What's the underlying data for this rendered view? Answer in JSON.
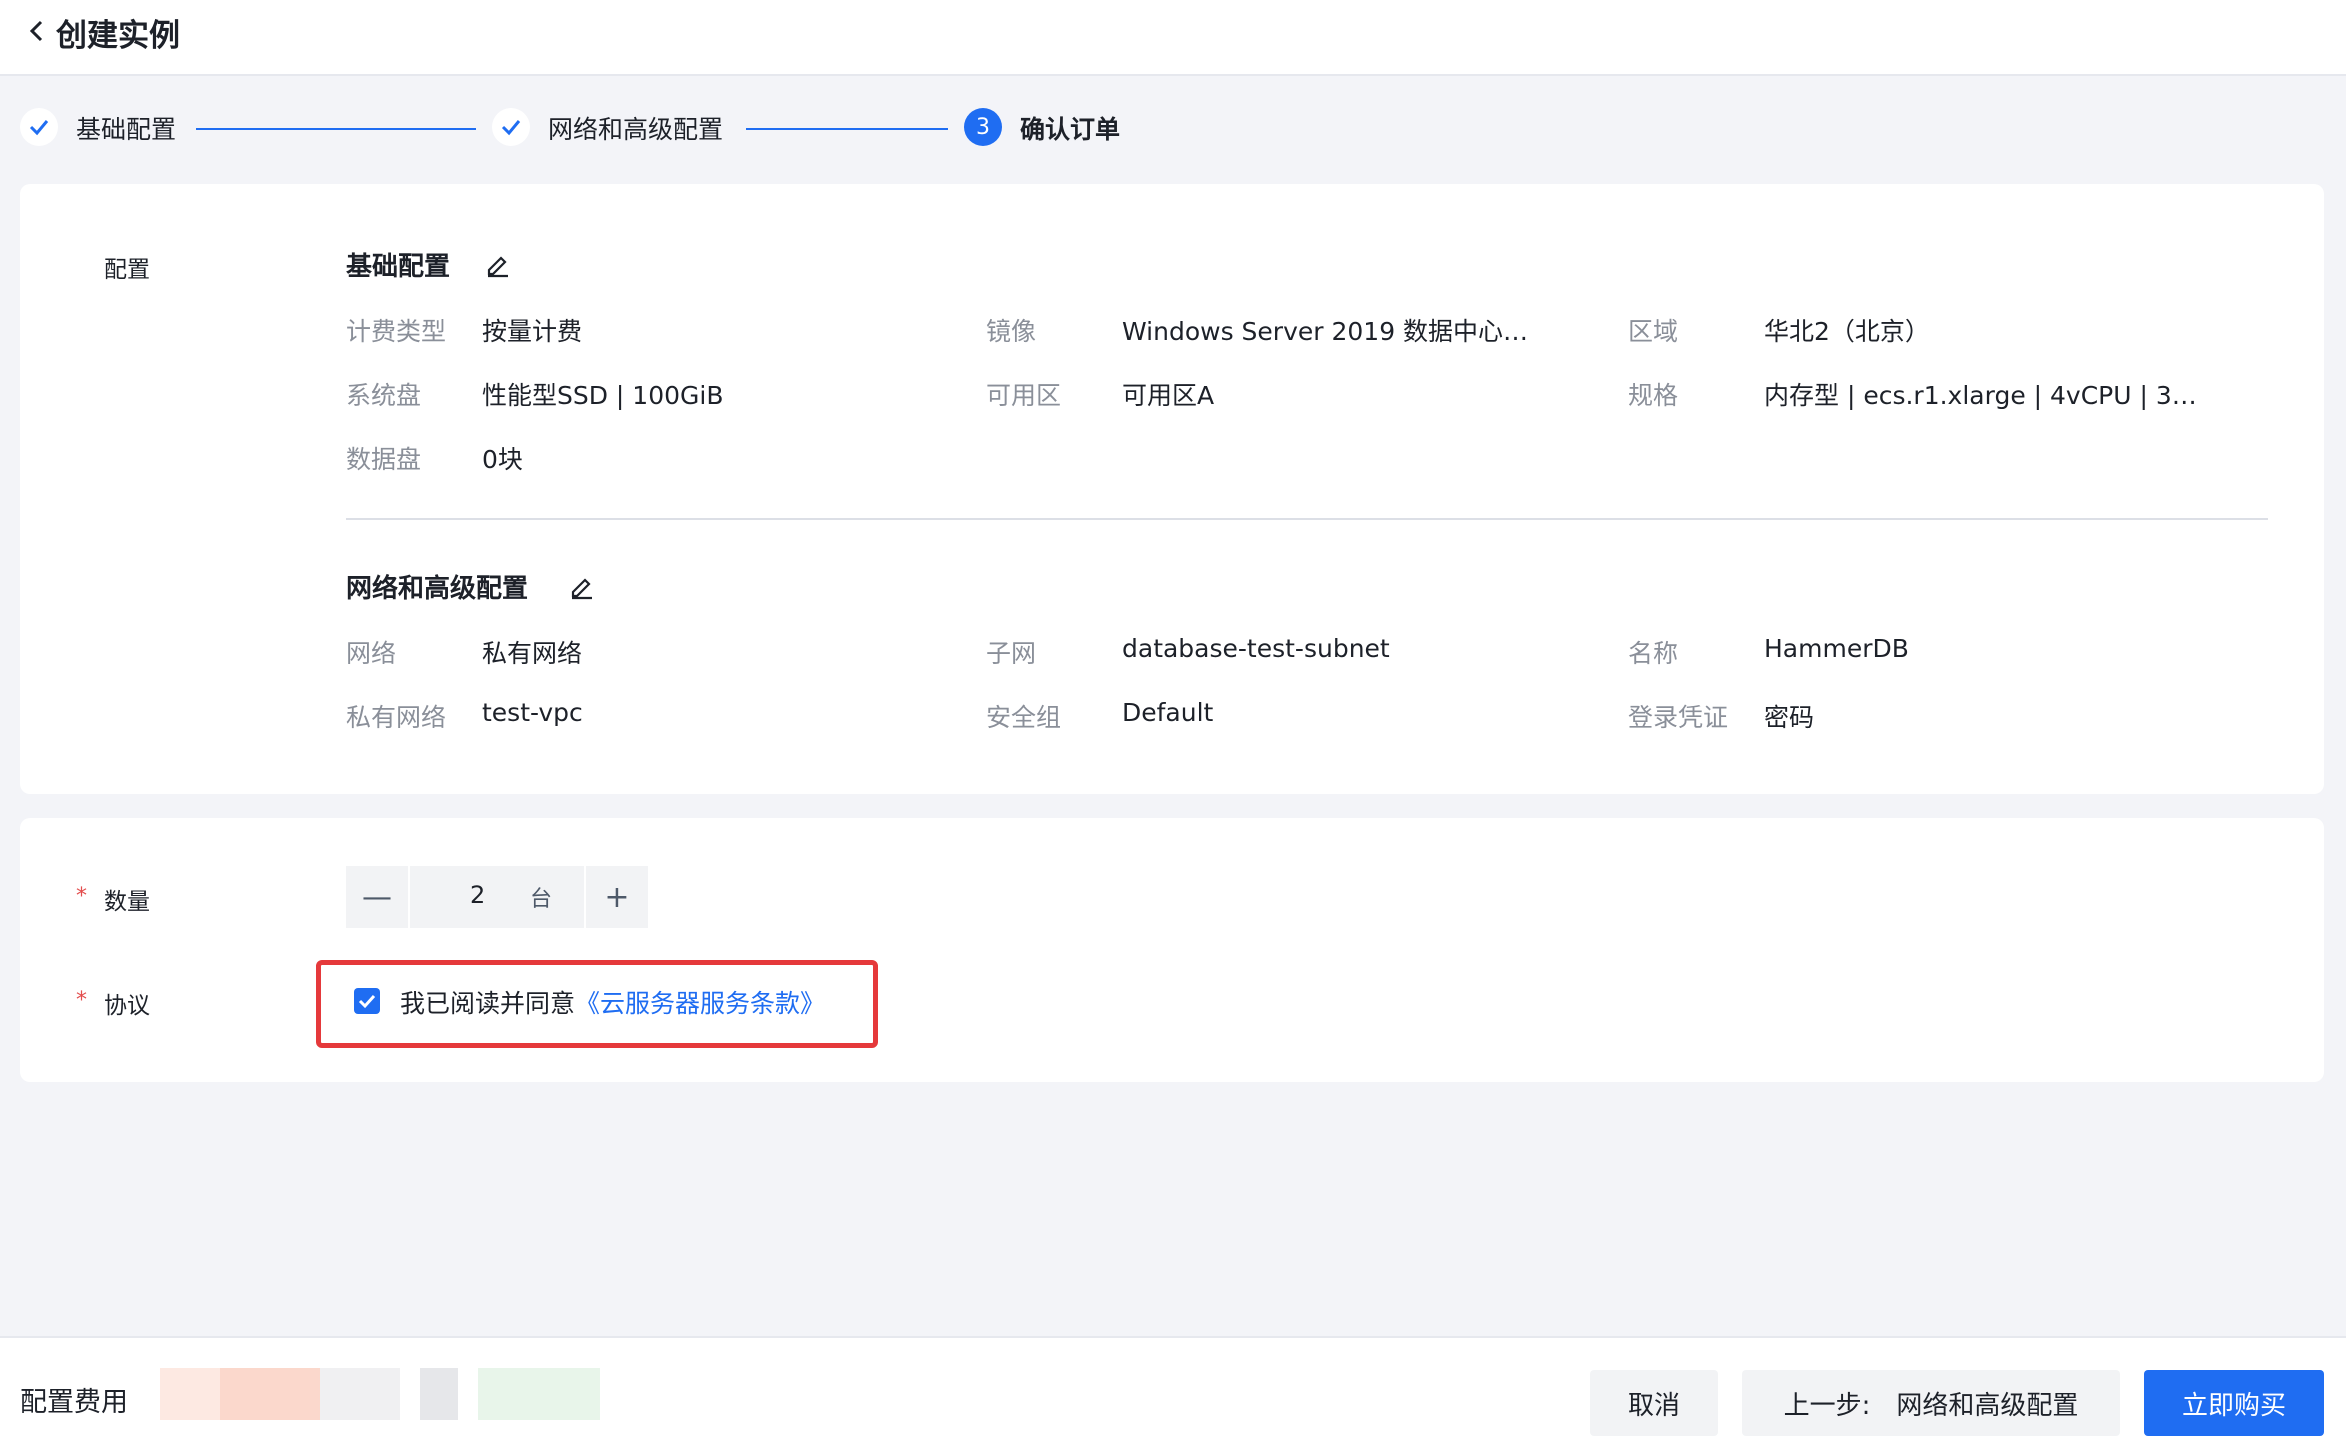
{
  "header": {
    "title": "创建实例"
  },
  "steps": [
    {
      "label": "基础配置",
      "state": "done"
    },
    {
      "label": "网络和高级配置",
      "state": "done"
    },
    {
      "label": "确认订单",
      "state": "active",
      "number": "3"
    }
  ],
  "config": {
    "row_label": "配置",
    "basic": {
      "title": "基础配置",
      "fields": [
        {
          "key": "计费类型",
          "value": "按量计费"
        },
        {
          "key": "镜像",
          "value": "Windows Server 2019 数据中心…"
        },
        {
          "key": "区域",
          "value": "华北2（北京）"
        },
        {
          "key": "系统盘",
          "value": "性能型SSD | 100GiB"
        },
        {
          "key": "可用区",
          "value": "可用区A"
        },
        {
          "key": "规格",
          "value": "内存型 | ecs.r1.xlarge | 4vCPU | 3…"
        },
        {
          "key": "数据盘",
          "value": "0块"
        }
      ]
    },
    "network": {
      "title": "网络和高级配置",
      "fields": [
        {
          "key": "网络",
          "value": "私有网络"
        },
        {
          "key": "子网",
          "value": "database-test-subnet"
        },
        {
          "key": "名称",
          "value": "HammerDB"
        },
        {
          "key": "私有网络",
          "value": "test-vpc"
        },
        {
          "key": "安全组",
          "value": "Default"
        },
        {
          "key": "登录凭证",
          "value": "密码"
        }
      ]
    }
  },
  "order": {
    "required_mark": "*",
    "quantity_label": "数量",
    "quantity_value": "2",
    "quantity_unit": "台",
    "minus": "—",
    "plus": "+",
    "agreement_label": "协议",
    "agreement_text": "我已阅读并同意",
    "agreement_link": "《云服务器服务条款》"
  },
  "footer": {
    "fee_label": "配置费用",
    "cancel": "取消",
    "prev": "上一步:　网络和高级配置",
    "buy": "立即购买"
  },
  "colors": {
    "primary": "#1f6df2",
    "highlight": "#e5393b",
    "muted": "#8a8f99"
  }
}
